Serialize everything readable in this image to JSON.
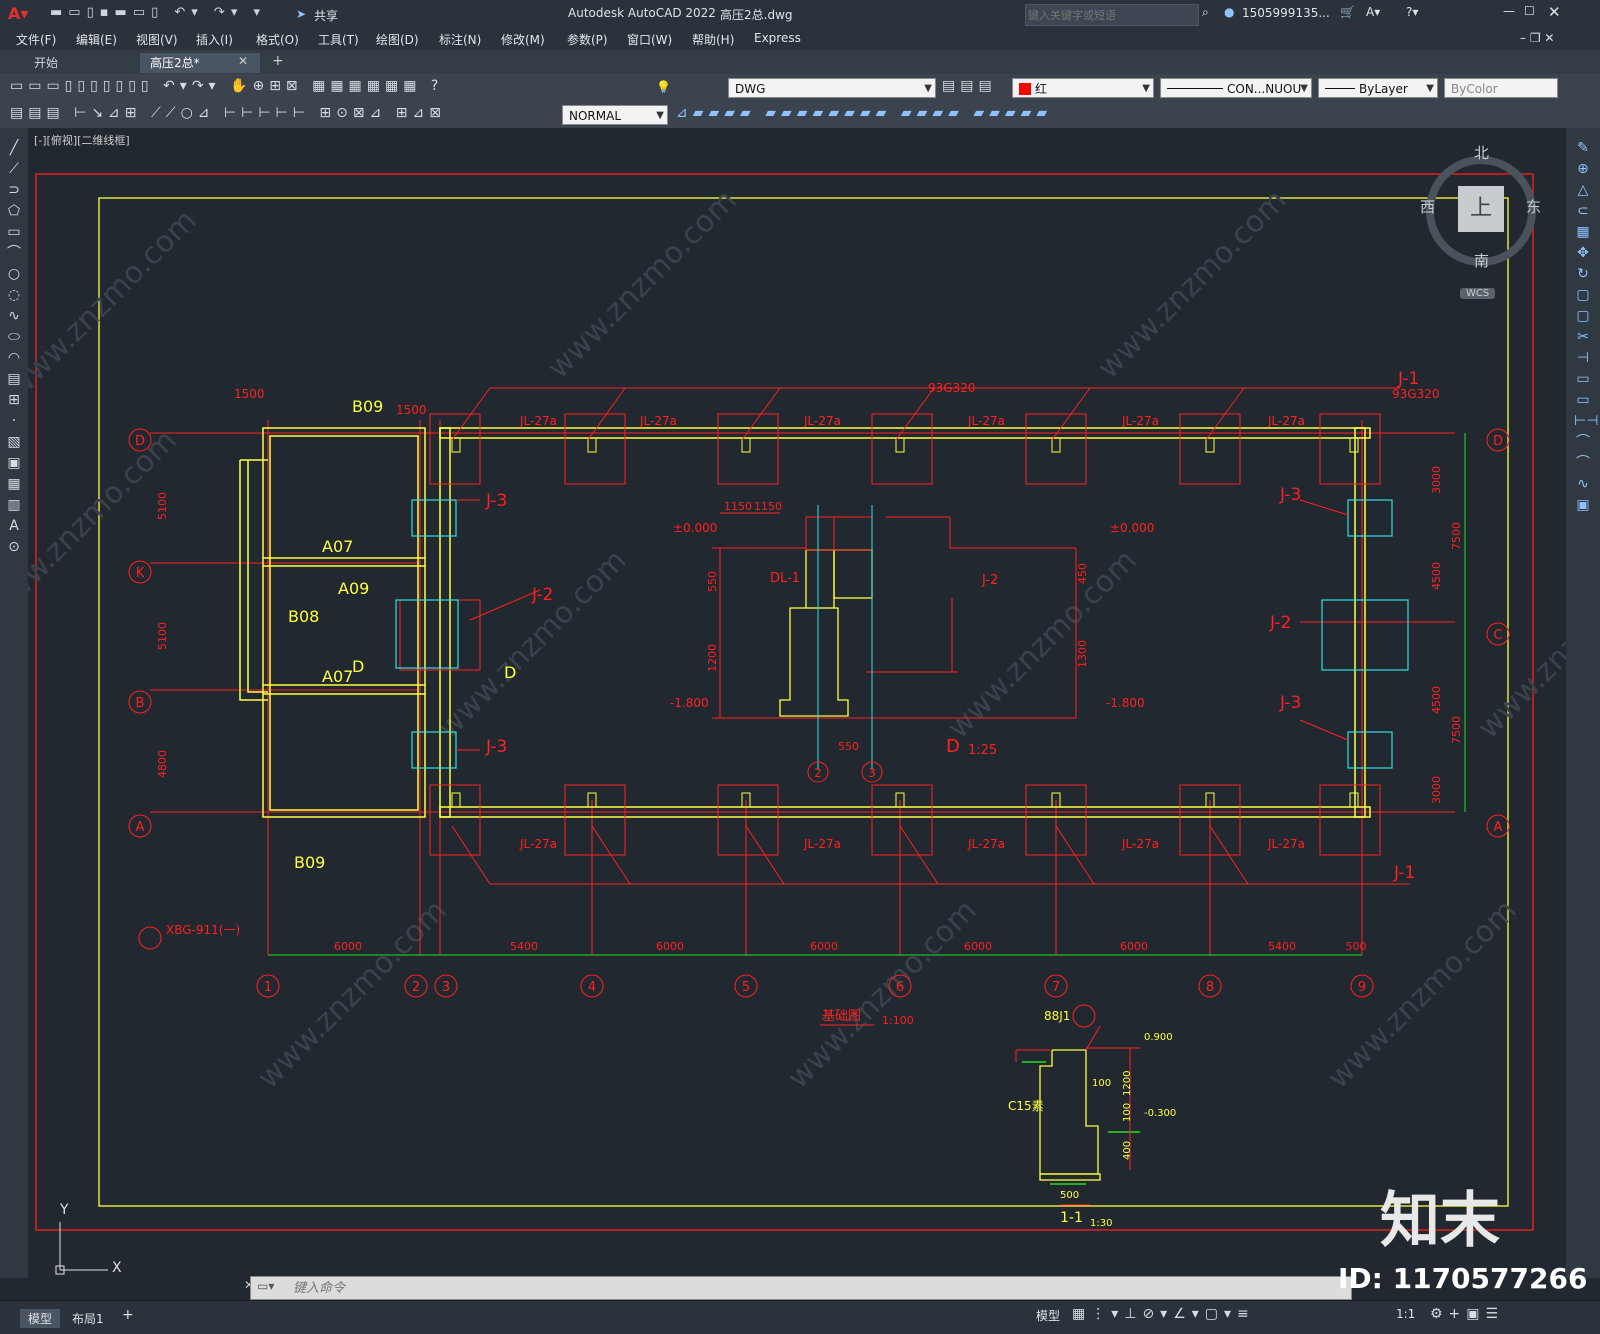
{
  "window": {
    "app_title": "Autodesk AutoCAD 2022",
    "doc_title": "高压2总.dwg",
    "share_label": "共享",
    "search_placeholder": "键入关键字或短语",
    "user": "1505999135...",
    "help_icon": "help-icon"
  },
  "menu": [
    "文件(F)",
    "编辑(E)",
    "视图(V)",
    "插入(I)",
    "格式(O)",
    "工具(T)",
    "绘图(D)",
    "标注(N)",
    "修改(M)",
    "参数(P)",
    "窗口(W)",
    "帮助(H)",
    "Express"
  ],
  "tabs": [
    {
      "label": "开始"
    },
    {
      "label": "高压2总*"
    }
  ],
  "toolbar": {
    "layer_value": "DWG",
    "color_value": "红",
    "linetype_value": "CON...NUOU",
    "lineweight_value": "ByLayer",
    "plotstyle_value": "ByColor",
    "textstyle_value": "NORMAL"
  },
  "colors": {
    "red": "#ff2020",
    "yellow": "#ffff40",
    "cyan": "#30e0e0",
    "green": "#20e020",
    "background": "#212830"
  },
  "viewport": {
    "label": "[-][俯视][二维线框]",
    "viewcube": {
      "north": "北",
      "south": "南",
      "east": "东",
      "west": "西",
      "top": "上",
      "wcs": "WCS"
    }
  },
  "drawing": {
    "plan_title": "基础图",
    "plan_scale": "1:100",
    "grid_numbers": [
      "1",
      "2",
      "3",
      "4",
      "5",
      "6",
      "7",
      "8",
      "9"
    ],
    "grid_letters_left": [
      "D",
      "K",
      "B",
      "A"
    ],
    "grid_letters_right": [
      "D",
      "C",
      "A"
    ],
    "bottom_dims": [
      "6000",
      "5400",
      "6000",
      "6000",
      "6000",
      "6000",
      "5400",
      "500"
    ],
    "left_dims": [
      "5100",
      "5100",
      "4800"
    ],
    "right_dims": [
      "3000",
      "4500",
      "4500",
      "3000",
      "7500",
      "7500"
    ],
    "beam_labels": [
      "JL-27a",
      "JL-27a",
      "JL-27a",
      "JL-27a",
      "JL-27a",
      "JL-27a"
    ],
    "footing_labels": [
      "J-1",
      "J-2",
      "J-3",
      "J-2",
      "J-3",
      "J-3",
      "J-1"
    ],
    "room_labels": [
      "B09",
      "A07",
      "A09",
      "B08",
      "A07",
      "D",
      "B09"
    ],
    "other_labels": [
      "93G320",
      "XBG-911(一)",
      "1500",
      "1500"
    ],
    "section": {
      "title": "D",
      "scale": "1:25",
      "elevations": [
        "±0.000",
        "±0.000",
        "-1.800",
        "-1.800"
      ],
      "dims": [
        "1150",
        "1150",
        "550",
        "1200",
        "550",
        "450",
        "1300",
        "550"
      ],
      "labels": [
        "DL-1",
        "J-2"
      ],
      "axes": [
        "2",
        "3"
      ]
    },
    "detail": {
      "title": "1-1",
      "scale": "1:30",
      "labels": [
        "88J1",
        "C15素",
        "0.900",
        "-0.300"
      ],
      "dims": [
        "100",
        "1200",
        "100",
        "400",
        "500"
      ]
    }
  },
  "command": {
    "placeholder": "键入命令"
  },
  "status": {
    "tabs": [
      "模型",
      "布局1"
    ],
    "model_label": "模型",
    "scale": "1:1"
  },
  "watermark": {
    "brand": "知末",
    "id": "ID: 1170577266",
    "site": "www.znzmo.com"
  }
}
